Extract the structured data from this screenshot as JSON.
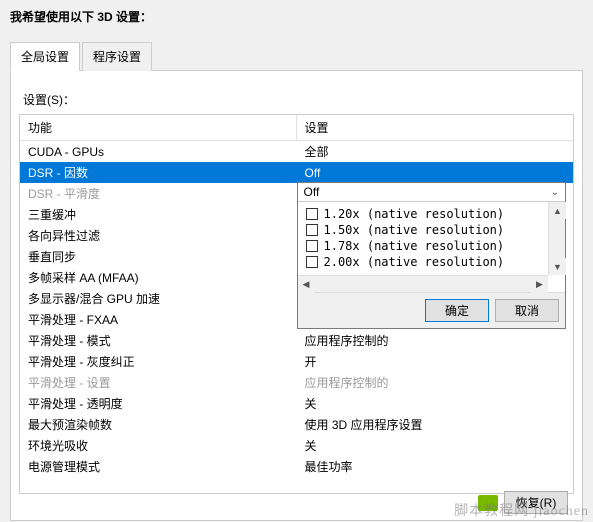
{
  "header": "我希望使用以下 3D 设置：",
  "tabs": {
    "global": "全局设置",
    "program": "程序设置"
  },
  "settings_label": "设置(S)：",
  "columns": {
    "feature": "功能",
    "setting": "设置"
  },
  "rows": [
    {
      "feature": "CUDA - GPUs",
      "value": "全部",
      "disabled": false
    },
    {
      "feature": "DSR - 因数",
      "value": "Off",
      "disabled": false,
      "selected": true
    },
    {
      "feature": "DSR - 平滑度",
      "value": "",
      "disabled": true
    },
    {
      "feature": "三重缓冲",
      "value": "",
      "disabled": false
    },
    {
      "feature": "各向异性过滤",
      "value": "",
      "disabled": false
    },
    {
      "feature": "垂直同步",
      "value": "",
      "disabled": false
    },
    {
      "feature": "多帧采样 AA (MFAA)",
      "value": "",
      "disabled": false
    },
    {
      "feature": "多显示器/混合 GPU 加速",
      "value": "",
      "disabled": false
    },
    {
      "feature": "平滑处理 - FXAA",
      "value": "",
      "disabled": false
    },
    {
      "feature": "平滑处理 - 模式",
      "value": "应用程序控制的",
      "disabled": false
    },
    {
      "feature": "平滑处理 - 灰度纠正",
      "value": "开",
      "disabled": false
    },
    {
      "feature": "平滑处理 - 设置",
      "value": "应用程序控制的",
      "disabled": true
    },
    {
      "feature": "平滑处理 - 透明度",
      "value": "关",
      "disabled": false
    },
    {
      "feature": "最大预渲染帧数",
      "value": "使用 3D 应用程序设置",
      "disabled": false
    },
    {
      "feature": "环境光吸收",
      "value": "关",
      "disabled": false
    },
    {
      "feature": "电源管理模式",
      "value": "最佳功率",
      "disabled": false
    }
  ],
  "dropdown": {
    "selected": "Off",
    "options": [
      "1.20x (native resolution)",
      "1.50x (native resolution)",
      "1.78x (native resolution)",
      "2.00x (native resolution)"
    ],
    "ok": "确定",
    "cancel": "取消"
  },
  "restore_button": "恢复(R)",
  "watermark": "脚本教程网 jiaochen"
}
